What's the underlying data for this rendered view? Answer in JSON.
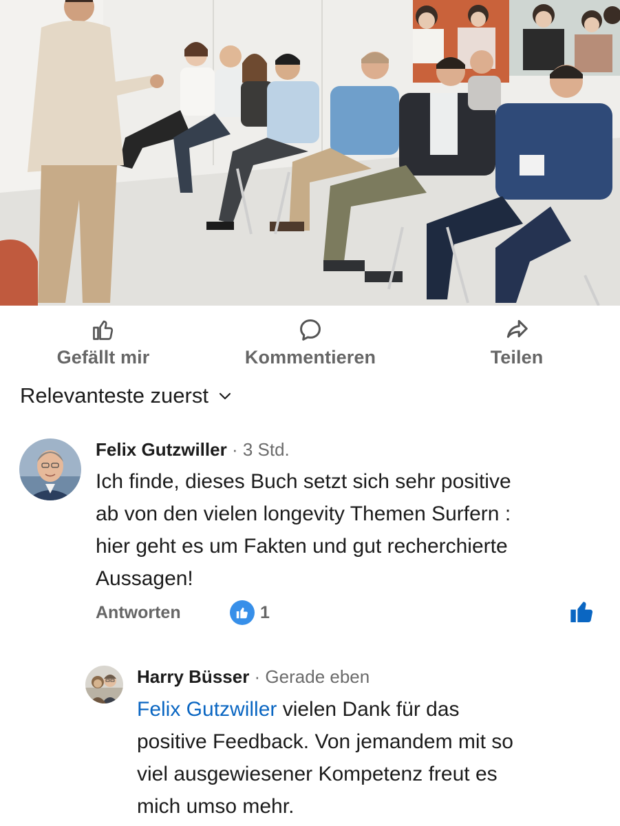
{
  "actions": {
    "like": "Gefällt mir",
    "comment": "Kommentieren",
    "share": "Teilen"
  },
  "sort": {
    "label": "Relevanteste zuerst"
  },
  "comments": [
    {
      "author": "Felix Gutzwiller",
      "meta": "· 3 Std.",
      "lines": [
        "Ich finde, dieses Buch setzt sich sehr positive",
        "ab von den vielen longevity Themen Surfern :",
        "hier geht es um Fakten und gut recherchierte",
        "Aussagen!"
      ],
      "reply_label": "Antworten",
      "like_count": "1"
    }
  ],
  "reply": {
    "author": "Harry Büsser",
    "meta": "· Gerade eben",
    "mention": "Felix Gutzwiller",
    "line1_rest": " vielen Dank für das",
    "lines": [
      "positive Feedback. Von jemandem mit so",
      "viel ausgewiesener Kompetenz freut es",
      "mich umso mehr."
    ]
  },
  "colors": {
    "link_blue": "#0a66c2",
    "reaction_blue": "#378fe9",
    "muted_gray": "#666666"
  },
  "icons": {
    "like": "thumbs-up-outline-icon",
    "comment": "speech-bubble-icon",
    "share": "share-arrow-icon",
    "sort": "chevron-down-icon",
    "reaction": "thumbs-up-filled-icon"
  }
}
